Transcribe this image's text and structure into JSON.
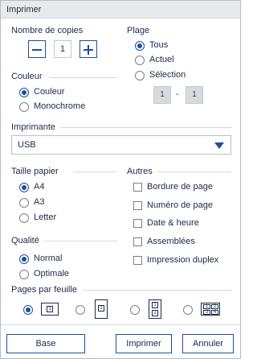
{
  "window": {
    "title": "Imprimer"
  },
  "copies": {
    "label": "Nombre de copies",
    "value": "1",
    "decrement_icon": "minus-icon",
    "increment_icon": "plus-icon"
  },
  "range": {
    "label": "Plage",
    "options": [
      "Tous",
      "Actuel",
      "Sélection"
    ],
    "selected": "Tous",
    "from": "1",
    "separator": "-",
    "to": "1"
  },
  "color": {
    "label": "Couleur",
    "options": [
      "Couleur",
      "Monochrome"
    ],
    "selected": "Couleur"
  },
  "printer": {
    "label": "Imprimante",
    "value": "USB",
    "dropdown_icon": "triangle-down-icon"
  },
  "paper": {
    "label": "Taille papier",
    "options": [
      "A4",
      "A3",
      "Letter"
    ],
    "selected": "A4"
  },
  "other": {
    "label": "Autres",
    "options": [
      "Bordure de page",
      "Numéro de page",
      "Date & heure",
      "Assemblées",
      "Impression duplex"
    ]
  },
  "quality": {
    "label": "Qualité",
    "options": [
      "Normal",
      "Optimale"
    ],
    "selected": "Normal"
  },
  "pages_per_sheet": {
    "label": "Pages par feuille",
    "options": [
      {
        "pages": "1",
        "icon": "one-page-icon"
      },
      {
        "pages": "1",
        "icon": "one-page-portrait-icon"
      },
      {
        "pages": "2",
        "icon": "two-pages-icon"
      },
      {
        "pages": "4",
        "icon": "four-pages-icon"
      }
    ],
    "selected_index": 0
  },
  "buttons": {
    "base": "Base",
    "print": "Imprimer",
    "cancel": "Annuler"
  },
  "colors": {
    "accent": "#1d4e9c",
    "text": "#1b2a4a",
    "separator": "#d5d9df"
  }
}
